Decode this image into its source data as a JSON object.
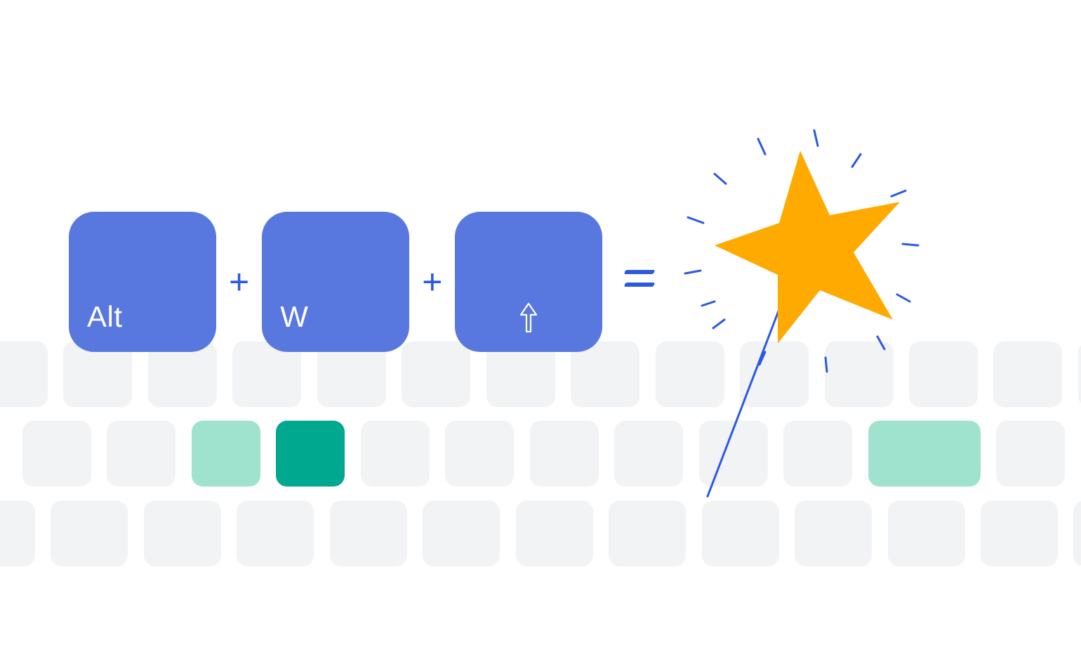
{
  "shortcut": {
    "key1_label": "Alt",
    "key2_label": "W",
    "key3_icon": "arrow-up",
    "separator": "+",
    "result": "magic"
  },
  "keyboard": {
    "row1_count": 14,
    "row2_count": 12,
    "row3_count": 13,
    "row2_highlight_mint_index": 2,
    "row2_highlight_teal_index": 3,
    "row2_highlight_mint_last_index": 10
  },
  "colors": {
    "key_blue": "#5878E0",
    "accent_blue": "#2B59E3",
    "star_orange": "#FFAA00",
    "key_grey": "#F1F3F5",
    "mint": "#9FE3CF",
    "teal": "#00A88F"
  }
}
